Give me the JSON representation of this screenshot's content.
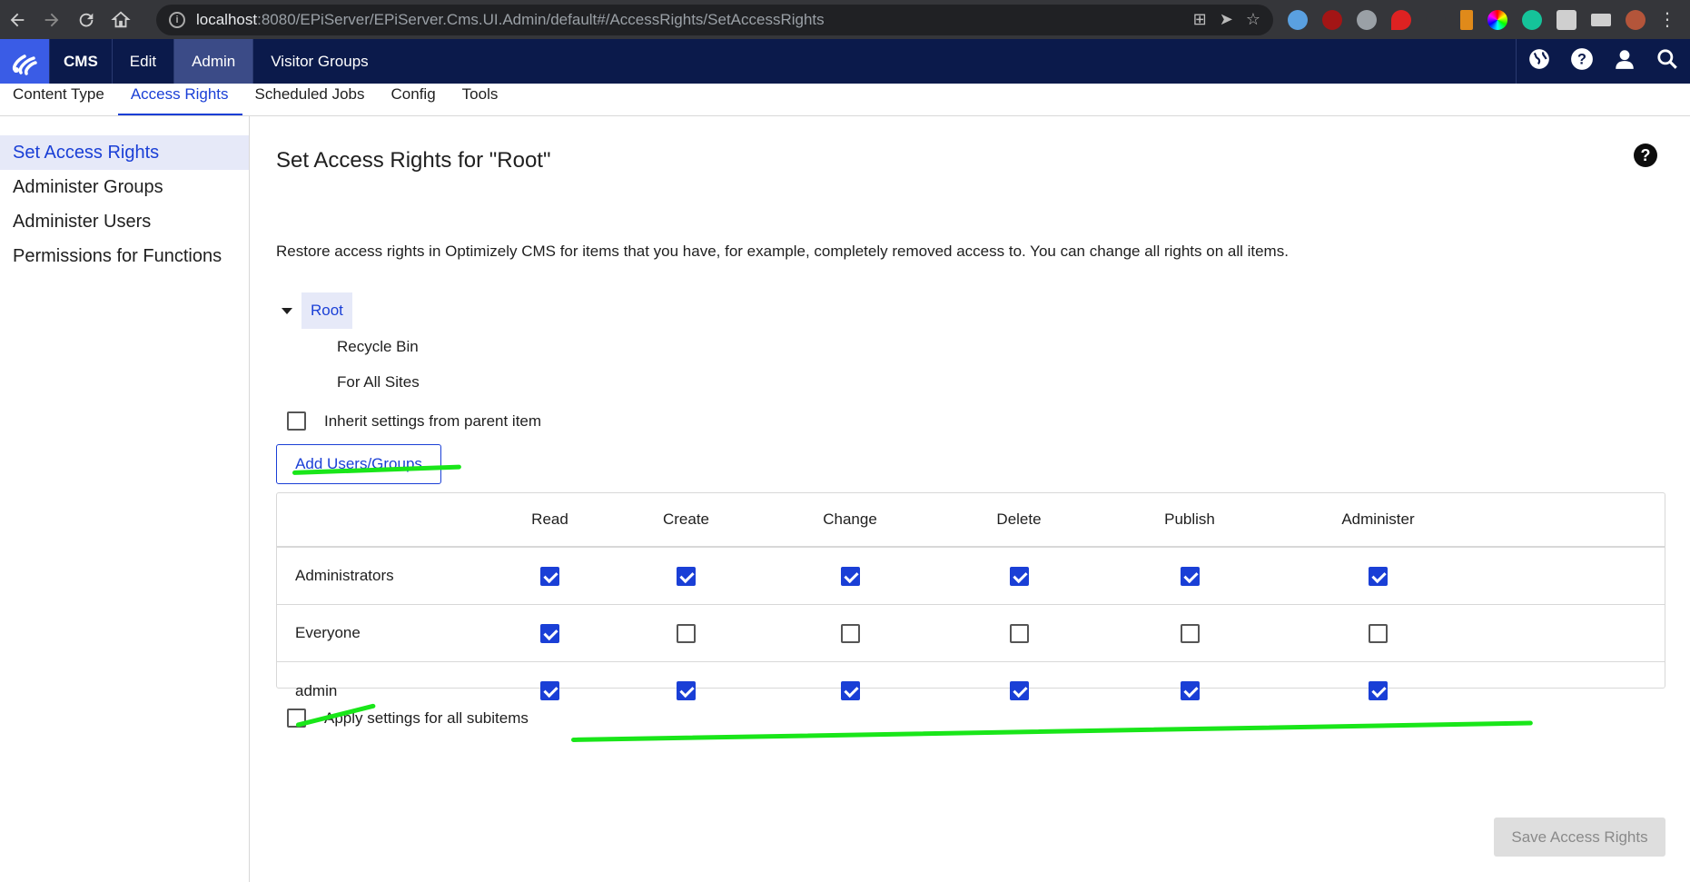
{
  "browser": {
    "url_host": "localhost",
    "url_path": ":8080/EPiServer/EPiServer.Cms.UI.Admin/default#/AccessRights/SetAccessRights"
  },
  "header": {
    "product": "CMS",
    "nav": [
      "Edit",
      "Admin",
      "Visitor Groups"
    ],
    "active_nav": "Admin",
    "icons": [
      "globe-icon",
      "help-icon",
      "user-icon",
      "search-icon"
    ]
  },
  "subtabs": [
    "Content Type",
    "Access Rights",
    "Scheduled Jobs",
    "Config",
    "Tools"
  ],
  "active_subtab": "Access Rights",
  "sidebar": {
    "items": [
      "Set Access Rights",
      "Administer Groups",
      "Administer Users",
      "Permissions for Functions"
    ],
    "active": "Set Access Rights"
  },
  "main": {
    "title": "Set Access Rights for \"Root\"",
    "description": "Restore access rights in Optimizely CMS for items that you have, for example, completely removed access to. You can change all rights on all items.",
    "tree": {
      "root": "Root",
      "children": [
        "Recycle Bin",
        "For All Sites"
      ]
    },
    "inherit_label": "Inherit settings from parent item",
    "inherit_checked": false,
    "add_button": "Add Users/Groups",
    "rights_columns": [
      "Read",
      "Create",
      "Change",
      "Delete",
      "Publish",
      "Administer"
    ],
    "rights_rows": [
      {
        "name": "Administrators",
        "values": [
          true,
          true,
          true,
          true,
          true,
          true
        ]
      },
      {
        "name": "Everyone",
        "values": [
          true,
          false,
          false,
          false,
          false,
          false
        ]
      },
      {
        "name": "admin",
        "values": [
          true,
          true,
          true,
          true,
          true,
          true
        ]
      }
    ],
    "apply_label": "Apply settings for all subitems",
    "apply_checked": false,
    "save_button": "Save Access Rights"
  },
  "colors": {
    "accent": "#1a3fd6",
    "header_bg": "#0b1a4b",
    "highlight_mark": "#19e619"
  }
}
